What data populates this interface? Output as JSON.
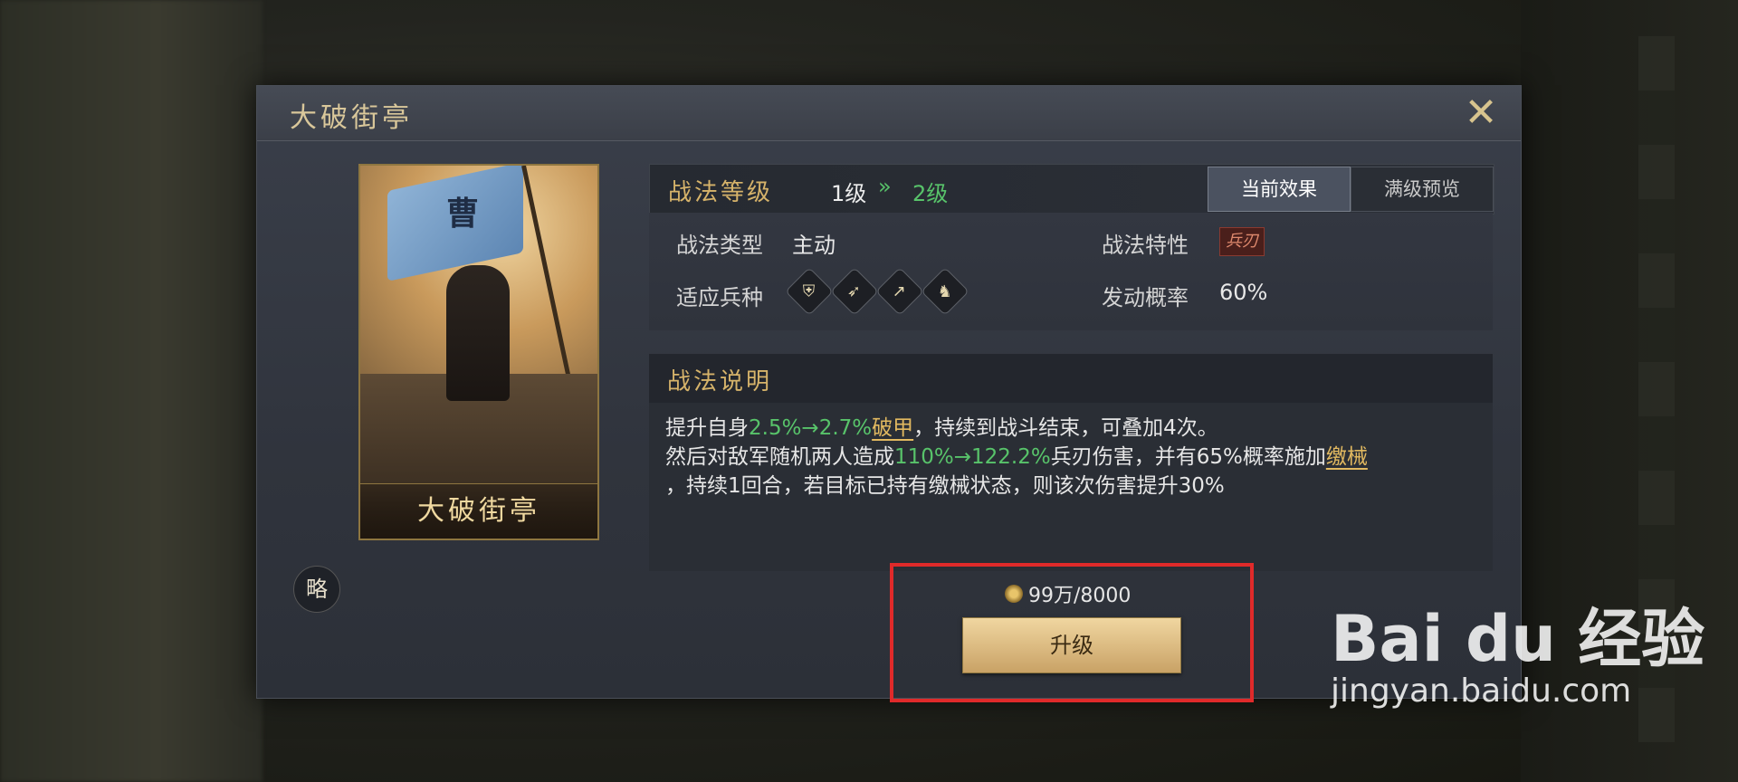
{
  "dialog": {
    "title": "大破街亭",
    "close_label": "✕"
  },
  "card": {
    "flag_char": "曹",
    "name": "大破街亭"
  },
  "strategy_badge": "略",
  "level": {
    "label": "战法等级",
    "current": "1级",
    "arrow": "»",
    "next": "2级"
  },
  "tabs": [
    {
      "label": "当前效果",
      "active": true
    },
    {
      "label": "满级预览",
      "active": false
    }
  ],
  "info": {
    "type_label": "战法类型",
    "type_value": "主动",
    "trait_label": "战法特性",
    "trait_value": "兵刃",
    "troops_label": "适应兵种",
    "troop_icons": [
      "shield-icon",
      "bow-icon",
      "spear-icon",
      "horse-icon"
    ],
    "rate_label": "发动概率",
    "rate_value": "60%"
  },
  "desc": {
    "title": "战法说明",
    "l1_a": "提升自身",
    "l1_g": "2.5%→2.7%",
    "l1_y": "破甲",
    "l1_b": "，持续到战斗结束，可叠加4次。",
    "l2_a": "然后对敌军随机两人造成",
    "l2_g": "110%→122.2%",
    "l2_b": "兵刃伤害，并有65%概率施加",
    "l2_y": "缴械",
    "l3": "，持续1回合，若目标已持有缴械状态，则该次伤害提升30%"
  },
  "cost": "99万/8000",
  "upgrade_label": "升级",
  "watermark": {
    "main": "Bai du 经验",
    "sub": "jingyan.baidu.com"
  }
}
